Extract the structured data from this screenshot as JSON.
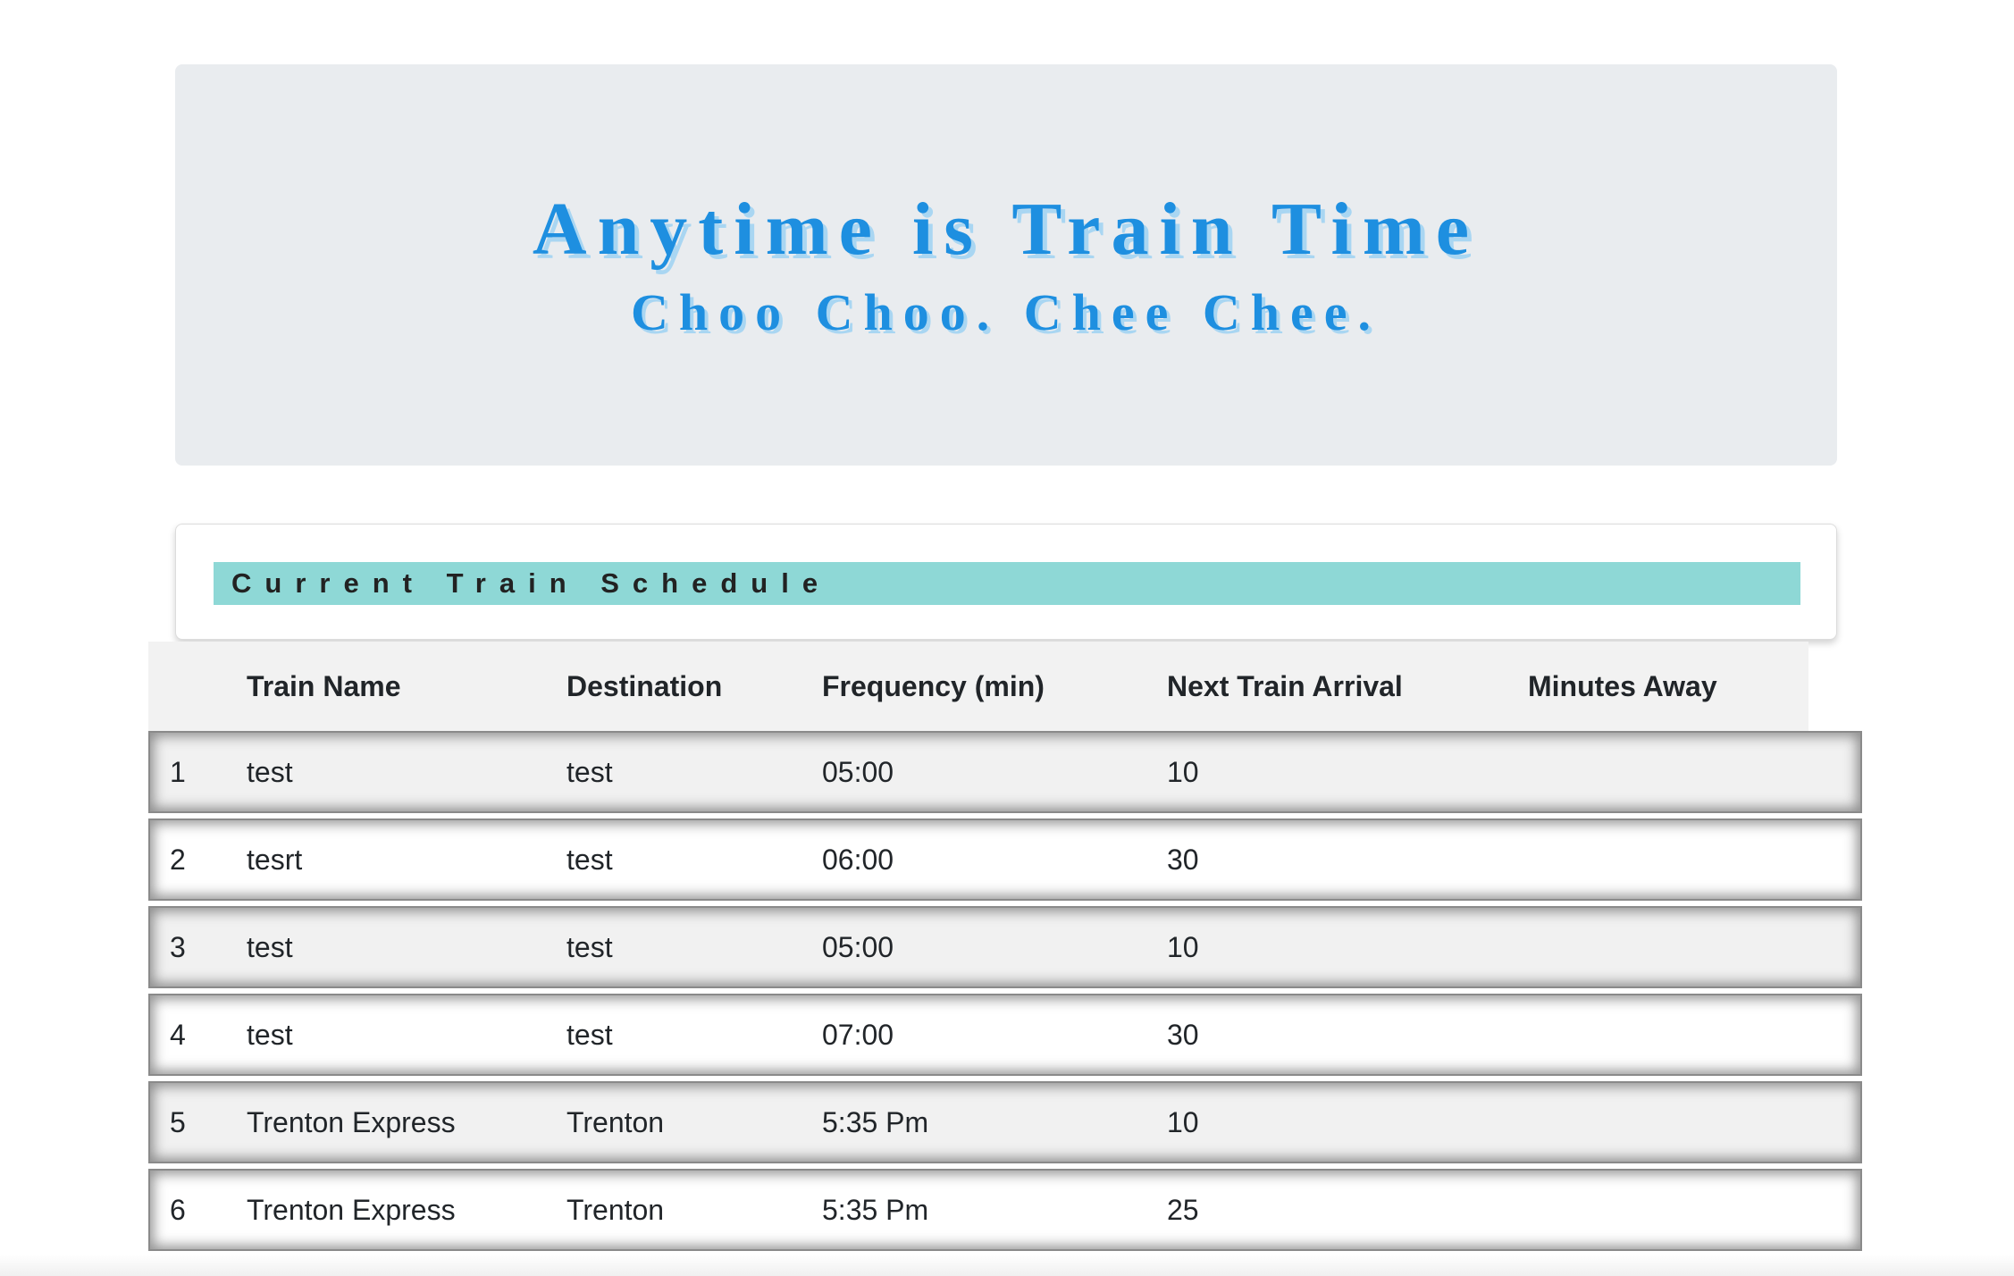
{
  "header": {
    "title": "Anytime is Train Time",
    "subtitle": "Choo Choo. Chee Chee."
  },
  "schedule": {
    "heading": "Current Train Schedule",
    "columns": [
      "",
      "Train Name",
      "Destination",
      "Frequency (min)",
      "Next Train Arrival",
      "Minutes Away"
    ],
    "rows": [
      {
        "num": "1",
        "name": "test",
        "destination": "test",
        "frequency": "05:00",
        "next_arrival": "10",
        "minutes_away": ""
      },
      {
        "num": "2",
        "name": "tesrt",
        "destination": "test",
        "frequency": "06:00",
        "next_arrival": "30",
        "minutes_away": ""
      },
      {
        "num": "3",
        "name": "test",
        "destination": "test",
        "frequency": "05:00",
        "next_arrival": "10",
        "minutes_away": ""
      },
      {
        "num": "4",
        "name": "test",
        "destination": "test",
        "frequency": "07:00",
        "next_arrival": "30",
        "minutes_away": ""
      },
      {
        "num": "5",
        "name": "Trenton Express",
        "destination": "Trenton",
        "frequency": "5:35 Pm",
        "next_arrival": "10",
        "minutes_away": ""
      },
      {
        "num": "6",
        "name": "Trenton Express",
        "destination": "Trenton",
        "frequency": "5:35 Pm",
        "next_arrival": "25",
        "minutes_away": ""
      }
    ]
  },
  "colors": {
    "title_blue": "#1e8fe0",
    "title_shadow": "#a9d6f2",
    "jumbotron_bg": "#e9ecef",
    "heading_bar": "#8ed8d6"
  }
}
